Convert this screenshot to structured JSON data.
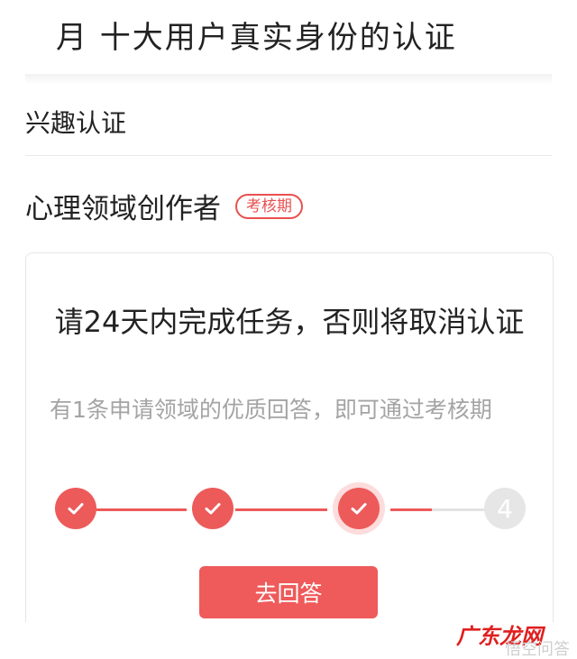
{
  "top": {
    "cut_text": "月 十大用户真实身份的认证"
  },
  "interest": {
    "header": "兴趣认证"
  },
  "certification": {
    "title": "心理领域创作者",
    "badge": "考核期"
  },
  "task": {
    "title": "请24天内完成任务，否则将取消认证",
    "description": "有1条申请领域的优质回答，即可通过考核期",
    "progress": {
      "completed_steps": 3,
      "total_steps": 4,
      "pending_label": "4"
    }
  },
  "action": {
    "answer_label": "去回答"
  },
  "watermark": {
    "brand": "广东龙网",
    "sub": "悟空问答"
  },
  "colors": {
    "accent": "#ef5a5a",
    "muted_text": "#a4a4a4",
    "border": "#e6e6e6"
  }
}
